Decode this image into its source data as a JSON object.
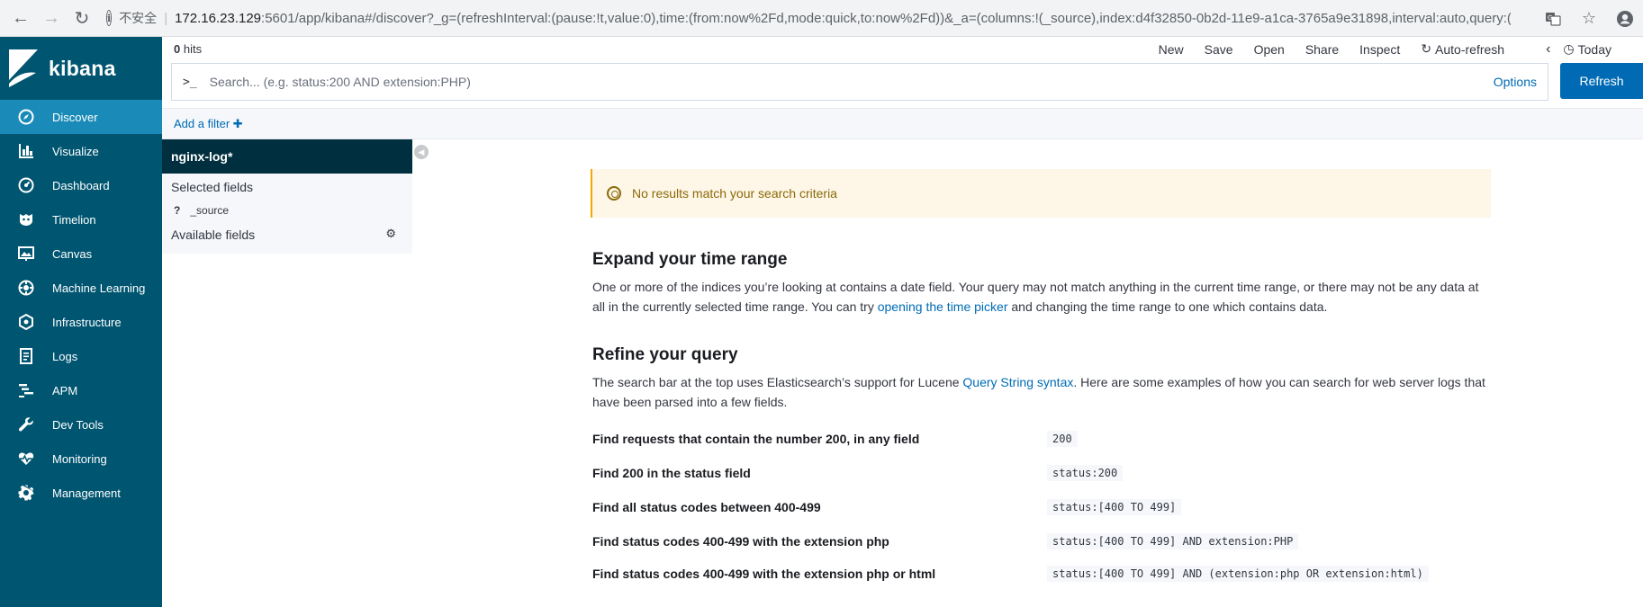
{
  "browser": {
    "insecure_label": "不安全",
    "url_host": "172.16.23.129",
    "url_rest": ":5601/app/kibana#/discover?_g=(refreshInterval:(pause:!t,value:0),time:(from:now%2Fd,mode:quick,to:now%2Fd))&_a=(columns:!(_source),index:d4f32850-0b2d-11e9-a1ca-3765a9e31898,interval:auto,query:(la..."
  },
  "brand": {
    "name": "kibana"
  },
  "nav": {
    "items": [
      {
        "label": "Discover",
        "icon": "compass-icon"
      },
      {
        "label": "Visualize",
        "icon": "bar-chart-icon"
      },
      {
        "label": "Dashboard",
        "icon": "dashboard-icon"
      },
      {
        "label": "Timelion",
        "icon": "timelion-icon"
      },
      {
        "label": "Canvas",
        "icon": "canvas-icon"
      },
      {
        "label": "Machine Learning",
        "icon": "ml-icon"
      },
      {
        "label": "Infrastructure",
        "icon": "infrastructure-icon"
      },
      {
        "label": "Logs",
        "icon": "logs-icon"
      },
      {
        "label": "APM",
        "icon": "apm-icon"
      },
      {
        "label": "Dev Tools",
        "icon": "wrench-icon"
      },
      {
        "label": "Monitoring",
        "icon": "heartbeat-icon"
      },
      {
        "label": "Management",
        "icon": "gear-icon"
      }
    ]
  },
  "toolbar": {
    "hits_count": "0",
    "hits_label": "hits",
    "new": "New",
    "save": "Save",
    "open": "Open",
    "share": "Share",
    "inspect": "Inspect",
    "auto_refresh": "Auto-refresh",
    "today": "Today"
  },
  "query": {
    "prompt": ">_",
    "placeholder": "Search... (e.g. status:200 AND extension:PHP)",
    "options": "Options",
    "refresh": "Refresh"
  },
  "filter": {
    "add": "Add a filter"
  },
  "fields": {
    "index_pattern": "nginx-log*",
    "selected_label": "Selected fields",
    "selected": [
      {
        "type": "?",
        "name": "_source"
      }
    ],
    "available_label": "Available fields"
  },
  "main": {
    "callout": "No results match your search criteria",
    "expand_title": "Expand your time range",
    "expand_p1": "One or more of the indices you’re looking at contains a date field. Your query may not match anything in the current time range, or there may not be any data at all in the currently selected time range. You can try ",
    "expand_link": "opening the time picker",
    "expand_p2": " and changing the time range to one which contains data.",
    "refine_title": "Refine your query",
    "refine_p1": "The search bar at the top uses Elasticsearch’s support for Lucene ",
    "refine_link": "Query String syntax",
    "refine_p2": ". Here are some examples of how you can search for web server logs that have been parsed into a few fields.",
    "examples": [
      {
        "label": "Find requests that contain the number 200, in any field",
        "code": "200"
      },
      {
        "label": "Find 200 in the status field",
        "code": "status:200"
      },
      {
        "label": "Find all status codes between 400-499",
        "code": "status:[400 TO 499]"
      },
      {
        "label": "Find status codes 400-499 with the extension php",
        "code": "status:[400 TO 499] AND extension:PHP"
      },
      {
        "label": "Find status codes 400-499 with the extension php or html",
        "code": "status:[400 TO 499] AND (extension:php OR extension:html)"
      }
    ]
  }
}
